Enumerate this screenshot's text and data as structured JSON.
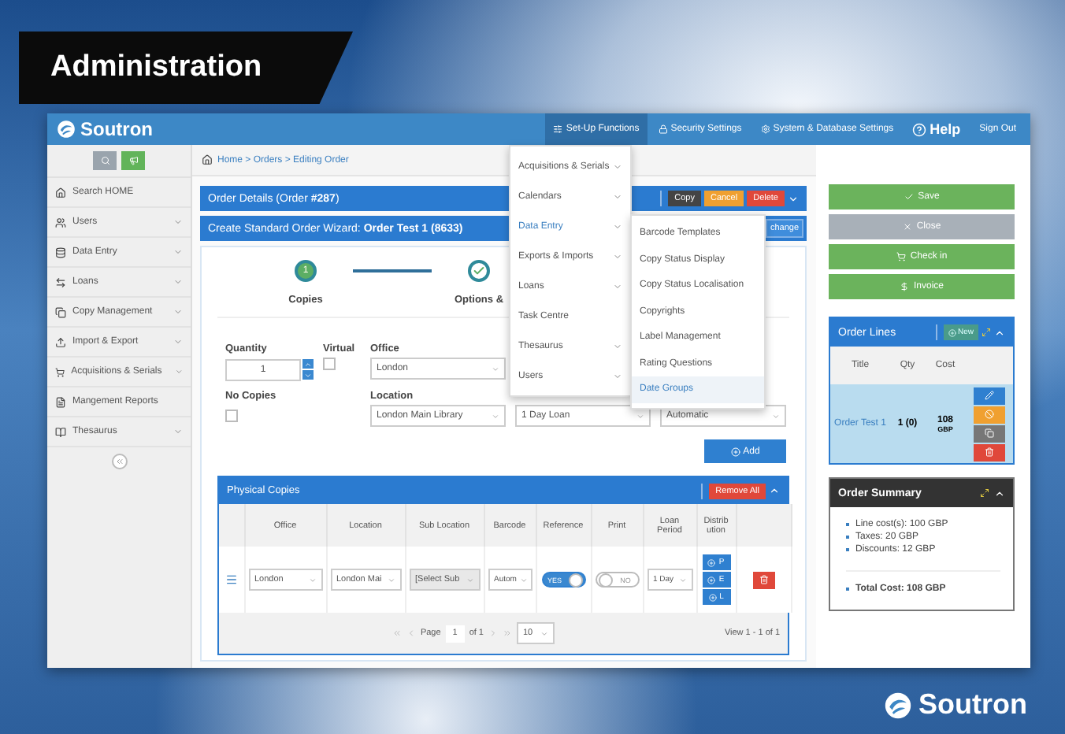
{
  "slide": {
    "title": "Administration",
    "footer_logo": "Soutron"
  },
  "header": {
    "logo": "Soutron",
    "nav": [
      {
        "label": "Set-Up Functions",
        "selected": true
      },
      {
        "label": "Security Settings",
        "selected": false
      },
      {
        "label": "System & Database Settings",
        "selected": false
      },
      {
        "label": "Help",
        "selected": false
      },
      {
        "label": "Sign Out",
        "selected": false
      }
    ]
  },
  "sidebar": {
    "items": [
      {
        "label": "Search HOME",
        "has_submenu": false
      },
      {
        "label": "Users",
        "has_submenu": true
      },
      {
        "label": "Data Entry",
        "has_submenu": true
      },
      {
        "label": "Loans",
        "has_submenu": true
      },
      {
        "label": "Copy Management",
        "has_submenu": true
      },
      {
        "label": "Import & Export",
        "has_submenu": true
      },
      {
        "label": "Acquisitions & Serials",
        "has_submenu": true
      },
      {
        "label": "Mangement Reports",
        "has_submenu": false
      },
      {
        "label": "Thesaurus",
        "has_submenu": true
      }
    ]
  },
  "breadcrumb": "Home > Orders > Editing Order",
  "setup_menu": {
    "items": [
      {
        "label": "Acquisitions & Serials",
        "has_submenu": true,
        "selected": false
      },
      {
        "label": "Calendars",
        "has_submenu": true,
        "selected": false
      },
      {
        "label": "Data Entry",
        "has_submenu": true,
        "selected": true
      },
      {
        "label": "Exports & Imports",
        "has_submenu": true,
        "selected": false
      },
      {
        "label": "Loans",
        "has_submenu": true,
        "selected": false
      },
      {
        "label": "Task Centre",
        "has_submenu": false,
        "selected": false
      },
      {
        "label": "Thesaurus",
        "has_submenu": true,
        "selected": false
      },
      {
        "label": "Users",
        "has_submenu": true,
        "selected": false
      }
    ],
    "submenu": [
      {
        "label": "Barcode Templates",
        "selected": false
      },
      {
        "label": "Copy Status Display",
        "selected": false
      },
      {
        "label": "Copy Status Localisation",
        "selected": false
      },
      {
        "label": "Copyrights",
        "selected": false
      },
      {
        "label": "Label Management",
        "selected": false
      },
      {
        "label": "Rating Questions",
        "selected": false
      },
      {
        "label": "Date Groups",
        "selected": true
      }
    ]
  },
  "order_bar": {
    "title": "Order Details (Order **#287**)",
    "buttons": [
      {
        "label": "Copy",
        "kind": "dark"
      },
      {
        "label": "Cancel",
        "kind": "warning"
      },
      {
        "label": "Delete",
        "kind": "danger"
      }
    ]
  },
  "wizard_bar": {
    "title": "Create Standard Order Wizard: **Order Test 1 (8633)**",
    "button": "change"
  },
  "steps": [
    {
      "number": "1",
      "label": "Copies",
      "current": true
    },
    {
      "label": "Options &",
      "current": false
    }
  ],
  "form": {
    "quantity": {
      "label": "Quantity",
      "value": "1"
    },
    "virtual": {
      "label": "Virtual",
      "checked": false
    },
    "office": {
      "label": "Office",
      "value": "London"
    },
    "location": {
      "label": "Location",
      "value": "London Main Library"
    },
    "no_copies": {
      "label": "No Copies",
      "checked": false
    },
    "loan_period": {
      "value": "1 Day Loan"
    },
    "column_5": {
      "value": "Automatic"
    },
    "add_button": "Add"
  },
  "physical_copies": {
    "title": "Physical Copies",
    "remove_all": "Remove All",
    "columns": [
      "Office",
      "Location",
      "Sub Location",
      "Barcode",
      "Reference",
      "Print",
      "Loan Period",
      "Distribution"
    ],
    "rows": [
      {
        "office": "London",
        "location": "London Mai",
        "sub_location": "[Select Sub",
        "sub_location_disabled": true,
        "barcode": "Autom",
        "reference": {
          "label": "YES",
          "on": true
        },
        "print": {
          "label": "NO",
          "on": false
        },
        "loan_period": "1 Day",
        "distribution": [
          "P",
          "E",
          "L"
        ]
      }
    ],
    "pager": {
      "page_label": "Page",
      "page": "1",
      "of": "of 1",
      "page_size": "10",
      "view": "View 1 - 1 of 1"
    }
  },
  "actions": [
    {
      "label": "Save",
      "kind": "success"
    },
    {
      "label": "Close",
      "kind": "muted"
    },
    {
      "label": "Check in",
      "kind": "success"
    },
    {
      "label": "Invoice",
      "kind": "success"
    }
  ],
  "order_lines": {
    "title": "Order Lines",
    "new_button": "New",
    "columns": [
      "Title",
      "Qty",
      "Cost"
    ],
    "rows": [
      {
        "title": "Order Test 1",
        "qty": "1 (0)",
        "cost": "108",
        "currency": "GBP",
        "selected": true
      }
    ]
  },
  "order_summary": {
    "title": "Order Summary",
    "lines": [
      "Line cost(s): 100 GBP",
      "Taxes: 20 GBP",
      "Discounts: 12 GBP"
    ],
    "total": "Total Cost: 108 GBP"
  }
}
